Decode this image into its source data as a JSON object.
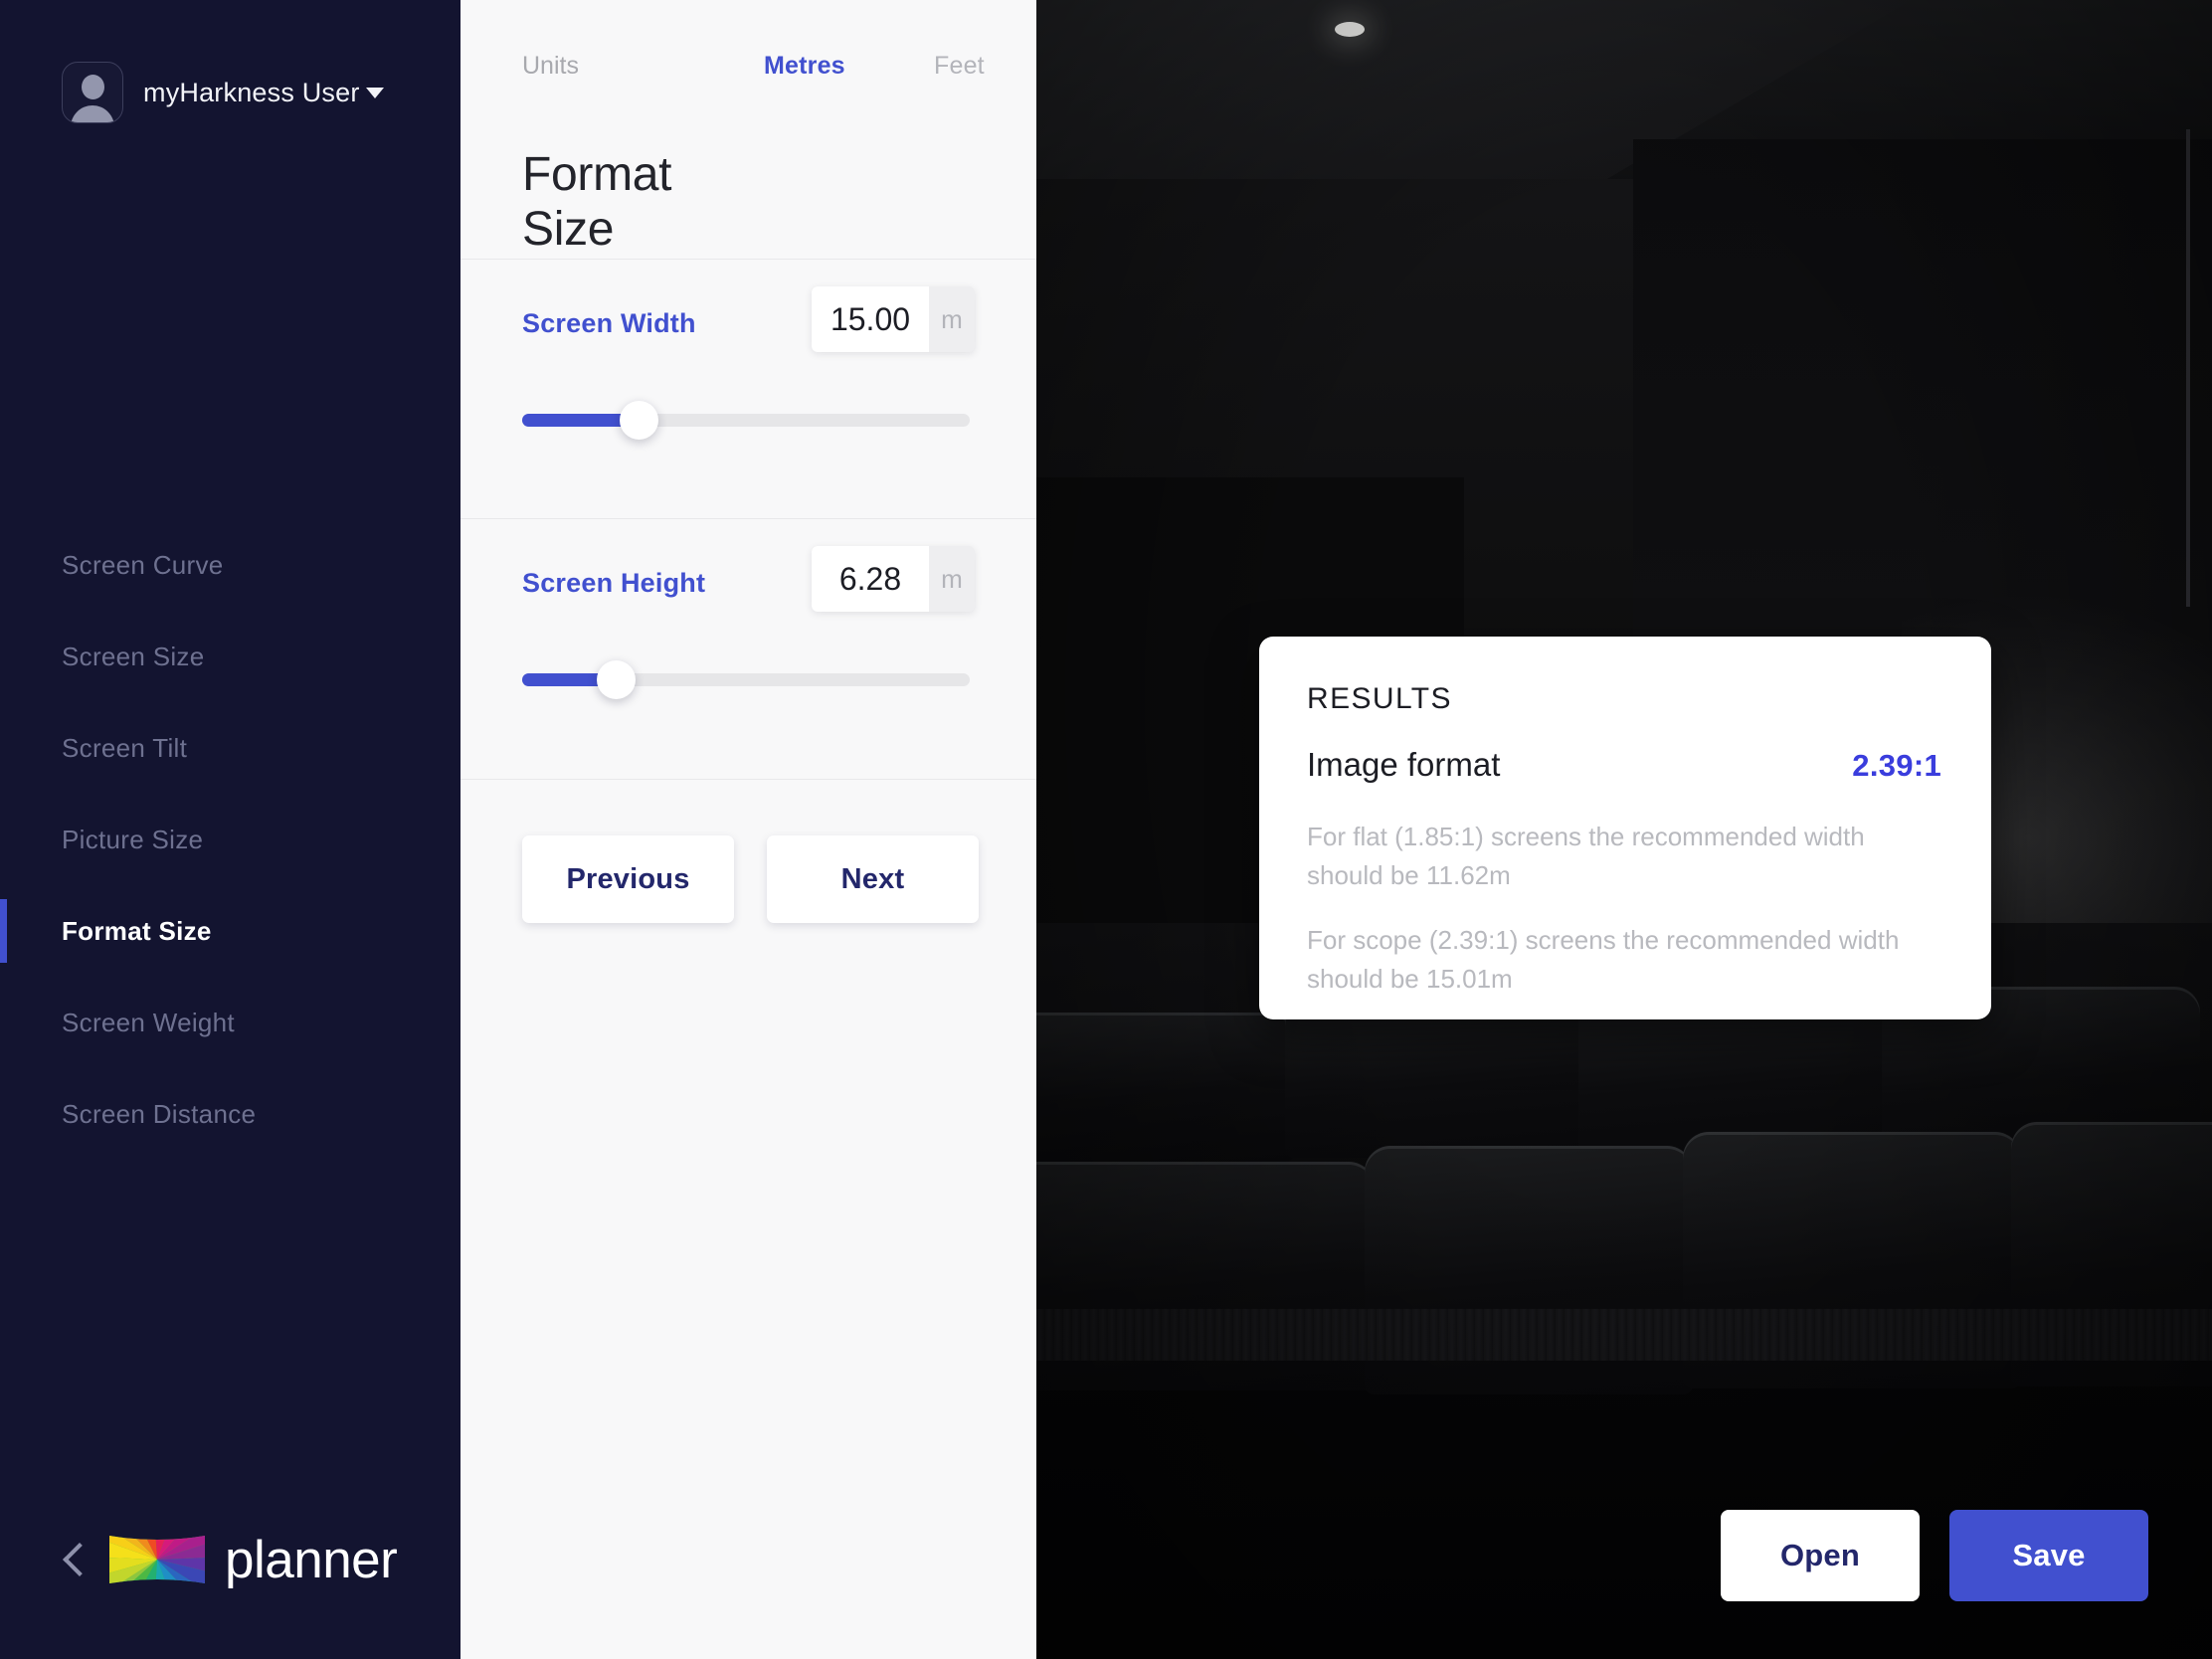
{
  "sidebar": {
    "user": {
      "name": "myHarkness User",
      "avatar_icon": "user-avatar-icon",
      "caret_icon": "caret-down-icon"
    },
    "items": [
      {
        "label": "Screen Curve",
        "active": false
      },
      {
        "label": "Screen Size",
        "active": false
      },
      {
        "label": "Screen Tilt",
        "active": false
      },
      {
        "label": "Picture Size",
        "active": false
      },
      {
        "label": "Format Size",
        "active": true
      },
      {
        "label": "Screen Weight",
        "active": false
      },
      {
        "label": "Screen Distance",
        "active": false
      }
    ],
    "brand": {
      "name": "planner",
      "back_icon": "chevron-left-icon",
      "logo_icon": "harkness-rainbow-screen-logo"
    }
  },
  "panel": {
    "units": {
      "label": "Units",
      "metres": "Metres",
      "feet": "Feet",
      "selected": "Metres"
    },
    "title": "Format Size",
    "fields": [
      {
        "label": "Screen Width",
        "value": "15.00",
        "unit": "m",
        "placeholder": "0.00",
        "slider_percent": 26
      },
      {
        "label": "Screen Height",
        "value": "6.28",
        "unit": "m",
        "placeholder": "0.00",
        "slider_percent": 21
      }
    ],
    "previous_label": "Previous",
    "next_label": "Next"
  },
  "results": {
    "title": "RESULTS",
    "image_format_label": "Image format",
    "image_format_value": "2.39:1",
    "note_flat": "For flat (1.85:1) screens the recommended width should be 11.62m",
    "note_scope": "For scope (2.39:1) screens the recommended width should be 15.01m"
  },
  "actions": {
    "open_label": "Open",
    "save_label": "Save"
  },
  "colors": {
    "accent": "#4150cf",
    "sidebar_bg": "#131430",
    "panel_bg": "#f8f8f9",
    "result_value": "#3a3ddd",
    "button_text": "#23276b"
  }
}
